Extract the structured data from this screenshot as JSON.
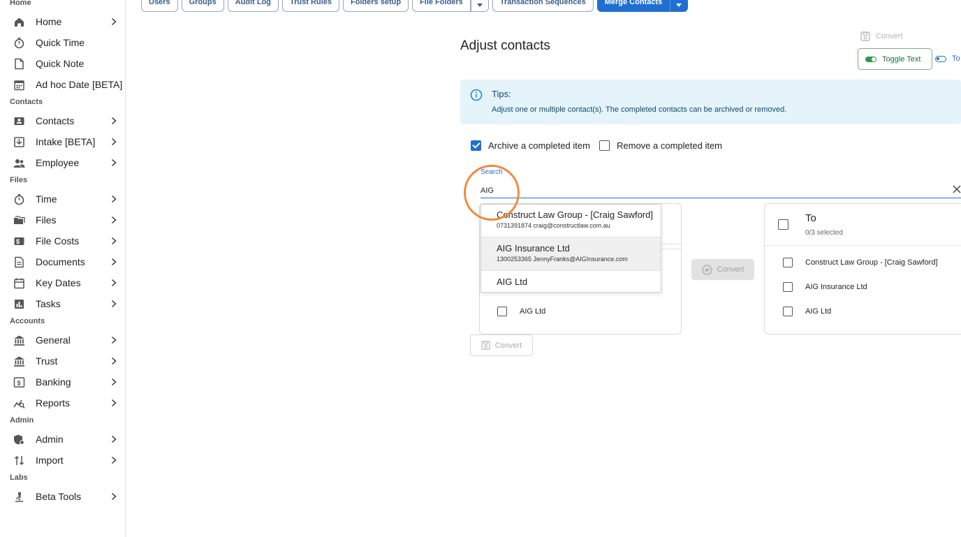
{
  "sidebar": {
    "sections": [
      {
        "label": "Home",
        "items": [
          {
            "label": "Home",
            "icon": "home-icon",
            "chevron": true
          },
          {
            "label": "Quick Time",
            "icon": "stopwatch-icon",
            "chevron": false
          },
          {
            "label": "Quick Note",
            "icon": "note-icon",
            "chevron": false
          },
          {
            "label": "Ad hoc Date [BETA]",
            "icon": "calendar-grid-icon",
            "chevron": false
          }
        ]
      },
      {
        "label": "Contacts",
        "items": [
          {
            "label": "Contacts",
            "icon": "contact-card-icon",
            "chevron": true
          },
          {
            "label": "Intake [BETA]",
            "icon": "inbox-icon",
            "chevron": true
          },
          {
            "label": "Employee",
            "icon": "people-icon",
            "chevron": true
          }
        ]
      },
      {
        "label": "Files",
        "items": [
          {
            "label": "Time",
            "icon": "stopwatch-icon",
            "chevron": true
          },
          {
            "label": "Files",
            "icon": "folders-icon",
            "chevron": true
          },
          {
            "label": "File Costs",
            "icon": "cost-icon",
            "chevron": true
          },
          {
            "label": "Documents",
            "icon": "document-icon",
            "chevron": true
          },
          {
            "label": "Key Dates",
            "icon": "calendar-icon",
            "chevron": true
          },
          {
            "label": "Tasks",
            "icon": "tasks-icon",
            "chevron": true
          }
        ]
      },
      {
        "label": "Accounts",
        "items": [
          {
            "label": "General",
            "icon": "bank-icon",
            "chevron": true
          },
          {
            "label": "Trust",
            "icon": "bank-icon",
            "chevron": true
          },
          {
            "label": "Banking",
            "icon": "banking-icon",
            "chevron": true
          },
          {
            "label": "Reports",
            "icon": "reports-icon",
            "chevron": true
          }
        ]
      },
      {
        "label": "Admin",
        "items": [
          {
            "label": "Admin",
            "icon": "admin-shield-icon",
            "chevron": true
          },
          {
            "label": "Import",
            "icon": "import-arrows-icon",
            "chevron": true
          }
        ]
      },
      {
        "label": "Labs",
        "items": [
          {
            "label": "Beta Tools",
            "icon": "microscope-icon",
            "chevron": true
          }
        ]
      }
    ]
  },
  "tabs": {
    "items": [
      "Users",
      "Groups",
      "Audit Log",
      "Trust Rules",
      "Folders setup"
    ],
    "file_folders": "File Folders",
    "transaction_sequences": "Transaction Sequences",
    "merge_contacts": "Merge Contacts"
  },
  "main": {
    "title": "Adjust contacts",
    "top_convert_label": "Convert",
    "toggle_text_label": "Toggle Text",
    "toggle2_label": "To",
    "tips": {
      "title": "Tips:",
      "body": "Adjust one or multiple contact(s). The completed contacts can be archived or removed."
    },
    "archive_label": "Archive a completed item",
    "archive_checked": true,
    "remove_label": "Remove a completed item",
    "remove_checked": false,
    "search": {
      "label": "Search",
      "value": "AIG"
    },
    "dropdown": [
      {
        "name": "Construct Law Group - [Craig Sawford]",
        "sub": "0731391874 craig@constructlaw.com.au"
      },
      {
        "name": "AIG Insurance Ltd",
        "sub": "1300253365 JennyFranks@AIGInsurance.com"
      },
      {
        "name": "AIG Ltd",
        "sub": ""
      }
    ],
    "left_panel_row": "AIG Ltd",
    "convert_mid_label": "Convert",
    "convert_left_label": "Convert",
    "to_panel": {
      "title": "To",
      "selected": "0/3 selected",
      "items": [
        "Construct Law Group - [Craig Sawford]",
        "AIG Insurance Ltd",
        "AIG Ltd"
      ]
    }
  },
  "colors": {
    "accent": "#1f6fd0",
    "highlight": "#f2893a",
    "tips_bg": "#e5f4fa",
    "toggle_green": "#2e9a47"
  }
}
